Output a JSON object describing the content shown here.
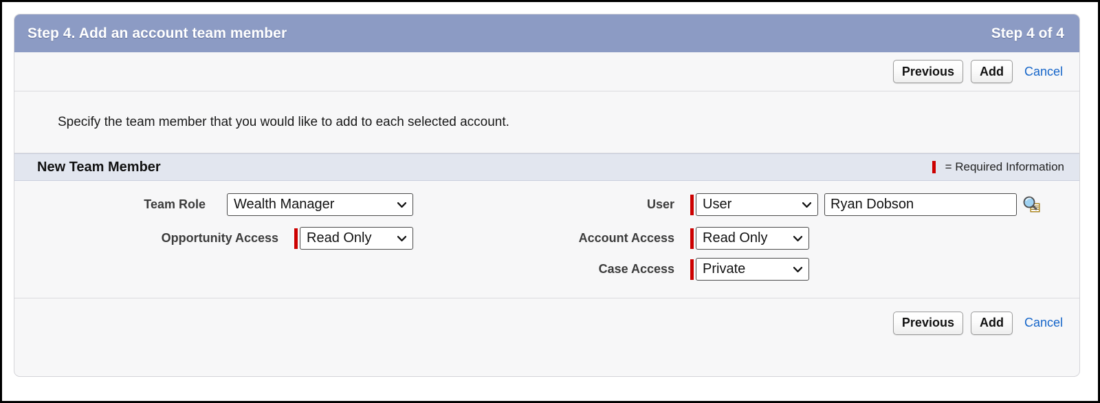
{
  "window": {
    "title": "Step 4. Add an account team member",
    "step_counter": "Step 4 of 4"
  },
  "toolbar": {
    "previous_label": "Previous",
    "add_label": "Add",
    "cancel_label": "Cancel"
  },
  "instructions": {
    "text": "Specify the team member that you would like to add to each selected account."
  },
  "section": {
    "title": "New Team Member",
    "required_note": "= Required Information",
    "required_color": "#cc0000"
  },
  "form": {
    "team_role": {
      "label": "Team Role",
      "value": "Wealth Manager",
      "required": false
    },
    "opportunity_access": {
      "label": "Opportunity Access",
      "value": "Read Only",
      "required": true
    },
    "user": {
      "label": "User",
      "type_value": "User",
      "name_value": "Ryan Dobson",
      "lookup_icon": "magnifying-glass-icon",
      "required": true
    },
    "account_access": {
      "label": "Account Access",
      "value": "Read Only",
      "required": true
    },
    "case_access": {
      "label": "Case Access",
      "value": "Private",
      "required": true
    }
  },
  "colors": {
    "header_blue": "#8c9bc4",
    "section_bg": "#e2e6ef",
    "link_blue": "#1565c9",
    "panel_bg": "#f7f7f8"
  }
}
